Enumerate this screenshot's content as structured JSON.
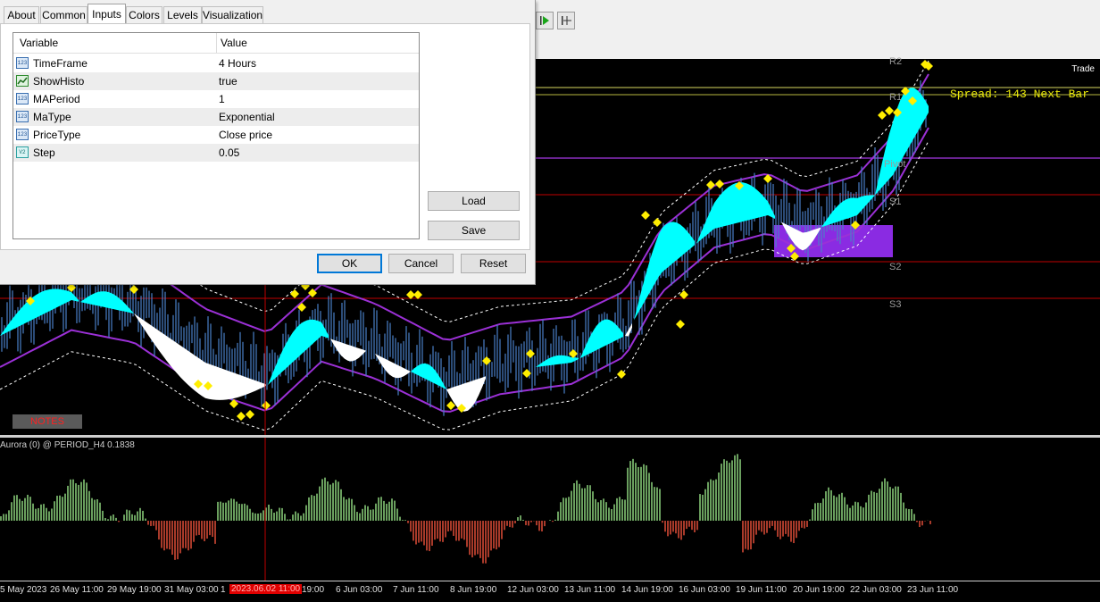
{
  "dialog": {
    "tabs": [
      {
        "label": "About"
      },
      {
        "label": "Common"
      },
      {
        "label": "Inputs"
      },
      {
        "label": "Colors"
      },
      {
        "label": "Levels"
      },
      {
        "label": "Visualization"
      }
    ],
    "active_tab": "Inputs",
    "table": {
      "headers": {
        "variable": "Variable",
        "value": "Value"
      },
      "rows": [
        {
          "icon": "123",
          "variable": "TimeFrame",
          "value": "4 Hours"
        },
        {
          "icon": "bool",
          "variable": "ShowHisto",
          "value": "true"
        },
        {
          "icon": "123",
          "variable": "MAPeriod",
          "value": "1"
        },
        {
          "icon": "123",
          "variable": "MaType",
          "value": "Exponential"
        },
        {
          "icon": "123",
          "variable": "PriceType",
          "value": "Close price"
        },
        {
          "icon": "V2",
          "variable": "Step",
          "value": "0.05"
        }
      ]
    },
    "buttons": {
      "load": "Load",
      "save": "Save",
      "ok": "OK",
      "cancel": "Cancel",
      "reset": "Reset"
    }
  },
  "chart": {
    "trade_label": "Trade",
    "spread_text": "Spread: 143 Next Bar",
    "levels": {
      "r2": "R2",
      "r1": "R1",
      "pivot": "Pivot",
      "s1": "S1",
      "s2": "S2",
      "s3": "S3"
    },
    "notes_label": "NOTES",
    "colors": {
      "cloud_up": "#00ffff",
      "cloud_down": "#ffffff",
      "envelope": "#9b30d6",
      "level_line": "#c00000",
      "signal": "#ffee00",
      "zone": "#9b30d6",
      "histo_up": "#6a9f5e",
      "histo_down": "#a83a2a",
      "candles": "#4a80c8"
    }
  },
  "subchart": {
    "title": "Aurora (0) @ PERIOD_H4 0.1838"
  },
  "time_axis": {
    "labels": [
      "5 May 2023",
      "26 May 11:00",
      "29 May 19:00",
      "31 May 03:00",
      "1",
      "19:00",
      "6 Jun 03:00",
      "7 Jun 11:00",
      "8 Jun 19:00",
      "12 Jun 03:00",
      "13 Jun 11:00",
      "14 Jun 19:00",
      "16 Jun 03:00",
      "19 Jun 11:00",
      "20 Jun 19:00",
      "22 Jun 03:00",
      "23 Jun 11:00"
    ],
    "highlight": "2023.06.02 11:00"
  },
  "toolbar": {
    "icons": [
      "play-icon",
      "crosshair-icon"
    ]
  }
}
